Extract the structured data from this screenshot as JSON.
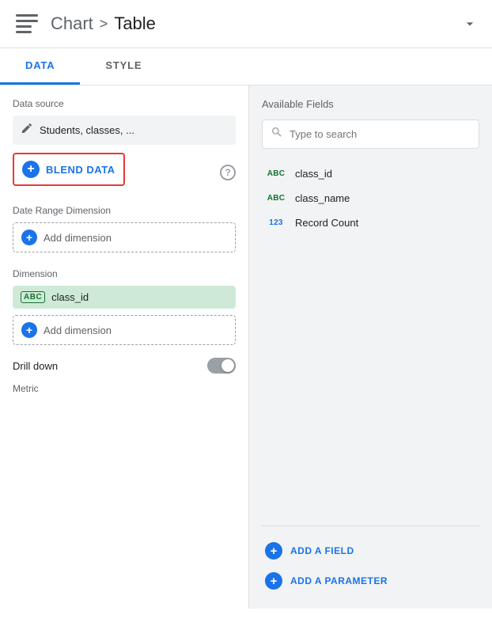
{
  "header": {
    "chart_label": "Chart",
    "separator": ">",
    "table_label": "Table",
    "chevron": "⌄"
  },
  "tabs": [
    {
      "id": "data",
      "label": "DATA",
      "active": true
    },
    {
      "id": "style",
      "label": "STYLE",
      "active": false
    }
  ],
  "left_panel": {
    "data_source_label": "Data source",
    "data_source_value": "Students, classes, ...",
    "blend_data_label": "BLEND DATA",
    "date_range_label": "Date Range Dimension",
    "add_dimension_label": "Add dimension",
    "dimension_label": "Dimension",
    "dimension_chip": {
      "type_badge": "ABC",
      "name": "class_id"
    },
    "add_dimension2_label": "Add dimension",
    "drill_down_label": "Drill down",
    "metric_label": "Metric"
  },
  "right_panel": {
    "available_fields_label": "Available Fields",
    "search_placeholder": "Type to search",
    "fields": [
      {
        "type": "ABC",
        "name": "class_id"
      },
      {
        "type": "ABC",
        "name": "class_name"
      },
      {
        "type": "123",
        "name": "Record Count"
      }
    ],
    "add_field_label": "ADD A FIELD",
    "add_parameter_label": "ADD A PARAMETER"
  },
  "icons": {
    "pencil": "✏",
    "search": "🔍",
    "question_mark": "?",
    "plus": "+"
  }
}
